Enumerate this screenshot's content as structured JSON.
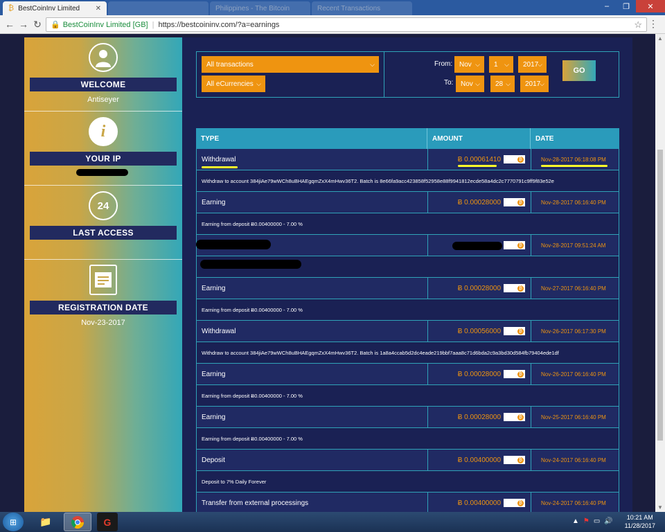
{
  "browser": {
    "tabs": [
      {
        "title": "BestCoinInv Limited",
        "active": true
      },
      {
        "title": "",
        "active": false
      },
      {
        "title": "",
        "active": false
      },
      {
        "title": "Philippines - The Bitcoin",
        "active": false
      },
      {
        "title": "Recent Transactions",
        "active": false
      }
    ],
    "secure_label": "BestCoinInv Limited [GB]",
    "url": "https://bestcoininv.com/?a=earnings"
  },
  "sidebar": {
    "welcome_label": "WELCOME",
    "username": "Antiseyer",
    "ip_label": "YOUR IP",
    "last_access_label": "LAST ACCESS",
    "reg_label": "REGISTRATION DATE",
    "reg_date": "Nov-23-2017",
    "clock_value": "24"
  },
  "filter": {
    "type_select": "All transactions",
    "currency_select": "All eCurrencies",
    "from_label": "From:",
    "to_label": "To:",
    "from_month": "Nov",
    "from_day": "1",
    "from_year": "2017",
    "to_month": "Nov",
    "to_day": "28",
    "to_year": "2017",
    "go_label": "GO"
  },
  "table": {
    "headers": [
      "TYPE",
      "AMOUNT",
      "DATE"
    ],
    "rows": [
      {
        "type": "Withdrawal",
        "amount": "Ƀ 0.00061410",
        "date": "Nov-28-2017 06:18:08 PM",
        "desc": "Withdraw to account 384jiAe79wWCh8uBHAEgqmZxX4mHwv36T2. Batch is 8e66fa9acc423858f52958e88f9941812ecde58a4dc2c7770791c9ff9f83e52e"
      },
      {
        "type": "Earning",
        "amount": "Ƀ 0.00028000",
        "date": "Nov-28-2017 06:16:40 PM",
        "desc": "Earning from deposit Ƀ0.00400000 - 7.00 %"
      },
      {
        "type": "",
        "amount": "Ƀ",
        "date": "Nov-28-2017 09:51:24 AM",
        "desc": ""
      },
      {
        "type": "Earning",
        "amount": "Ƀ 0.00028000",
        "date": "Nov-27-2017 06:16:40 PM",
        "desc": "Earning from deposit Ƀ0.00400000 - 7.00 %"
      },
      {
        "type": "Withdrawal",
        "amount": "Ƀ 0.00056000",
        "date": "Nov-26-2017 06:17:30 PM",
        "desc": "Withdraw to account 384jiAe79wWCh8uBHAEgqmZxX4mHwv36T2. Batch is 1a8a4ccab5d2dc4eade219bbf7aaa8c71d6bda2c9a3bd30d584fb79404ede1df"
      },
      {
        "type": "Earning",
        "amount": "Ƀ 0.00028000",
        "date": "Nov-26-2017 06:16:40 PM",
        "desc": "Earning from deposit Ƀ0.00400000 - 7.00 %"
      },
      {
        "type": "Earning",
        "amount": "Ƀ 0.00028000",
        "date": "Nov-25-2017 06:16:40 PM",
        "desc": "Earning from deposit Ƀ0.00400000 - 7.00 %"
      },
      {
        "type": "Deposit",
        "amount": "Ƀ 0.00400000",
        "date": "Nov-24-2017 06:16:40 PM",
        "desc": "Deposit to 7% Daily Forever"
      },
      {
        "type": "Transfer from external processings",
        "amount": "Ƀ 0.00400000",
        "date": "Nov-24-2017 06:16:40 PM",
        "desc": ""
      }
    ]
  },
  "taskbar": {
    "time": "10:21 AM",
    "date": "11/28/2017"
  },
  "colors": {
    "accent_orange": "#ef9410",
    "teal": "#2a9bbb",
    "navy": "#1a2154",
    "highlight": "#ffff2a"
  }
}
